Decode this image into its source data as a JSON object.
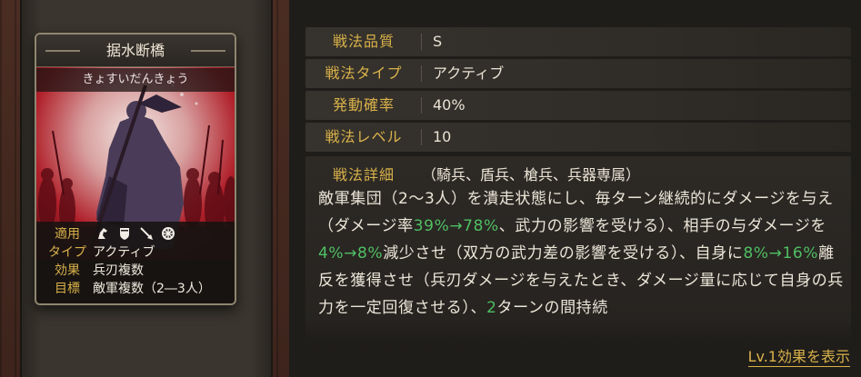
{
  "card": {
    "name": "据水断橋",
    "reading": "きょすいだんきょう",
    "info": [
      {
        "key": "適用",
        "value": ""
      },
      {
        "key": "タイプ",
        "value": "アクティブ"
      },
      {
        "key": "効果",
        "value": "兵刃複数"
      },
      {
        "key": "目標",
        "value": "敵軍複数（2―3人）"
      }
    ],
    "unit_icons": [
      "cavalry-icon",
      "shield-icon",
      "spear-icon",
      "siege-wheel-icon"
    ]
  },
  "stats": [
    {
      "label": "戦法品質",
      "value": "S"
    },
    {
      "label": "戦法タイプ",
      "value": "アクティブ"
    },
    {
      "label": "発動確率",
      "value": "40%"
    },
    {
      "label": "戦法レベル",
      "value": "10"
    }
  ],
  "detail": {
    "label": "戦法詳細",
    "applies": "（騎兵、盾兵、槍兵、兵器専属）",
    "segments": [
      {
        "t": "敵軍集団（2〜3人）を潰走状態にし、毎ターン継続的にダメージを与え（ダメージ率",
        "g": false
      },
      {
        "t": "39%→78%",
        "g": true
      },
      {
        "t": "、武力の影響を受ける）、相手の与ダメージを",
        "g": false
      },
      {
        "t": "4%→8%",
        "g": true
      },
      {
        "t": "減少させ（双方の武力差の影響を受ける）、自身に",
        "g": false
      },
      {
        "t": "8%→16%",
        "g": true
      },
      {
        "t": "離反を獲得させ（兵刃ダメージを与えたとき、ダメージ量に応じて自身の兵力を一定回復させる）、",
        "g": false
      },
      {
        "t": "2",
        "g": true
      },
      {
        "t": "ターンの間持続",
        "g": false
      }
    ]
  },
  "lv_link": "Lv.1効果を表示",
  "colors": {
    "label_gold": "#d9b24a",
    "highlight_green": "#4fbf62",
    "card_red": "#b0202a"
  }
}
